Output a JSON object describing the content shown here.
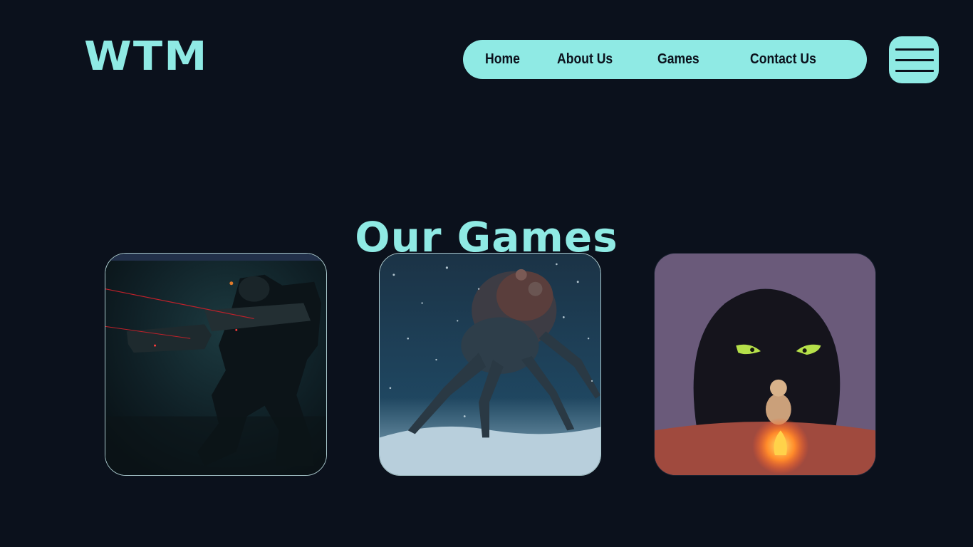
{
  "header": {
    "logo_text": "WTM"
  },
  "nav": {
    "items": [
      {
        "label": "Home"
      },
      {
        "label": "About Us"
      },
      {
        "label": "Games"
      },
      {
        "label": "Contact Us"
      }
    ],
    "menu_icon": "hamburger-menu-icon"
  },
  "main": {
    "section_title": "Our Games",
    "games": [
      {
        "image": "mech-soldier-dark-artwork"
      },
      {
        "image": "spider-creature-snow-artwork"
      },
      {
        "image": "cave-monster-campfire-artwork"
      }
    ]
  },
  "colors": {
    "background": "#0b111c",
    "accent": "#8feae4"
  }
}
